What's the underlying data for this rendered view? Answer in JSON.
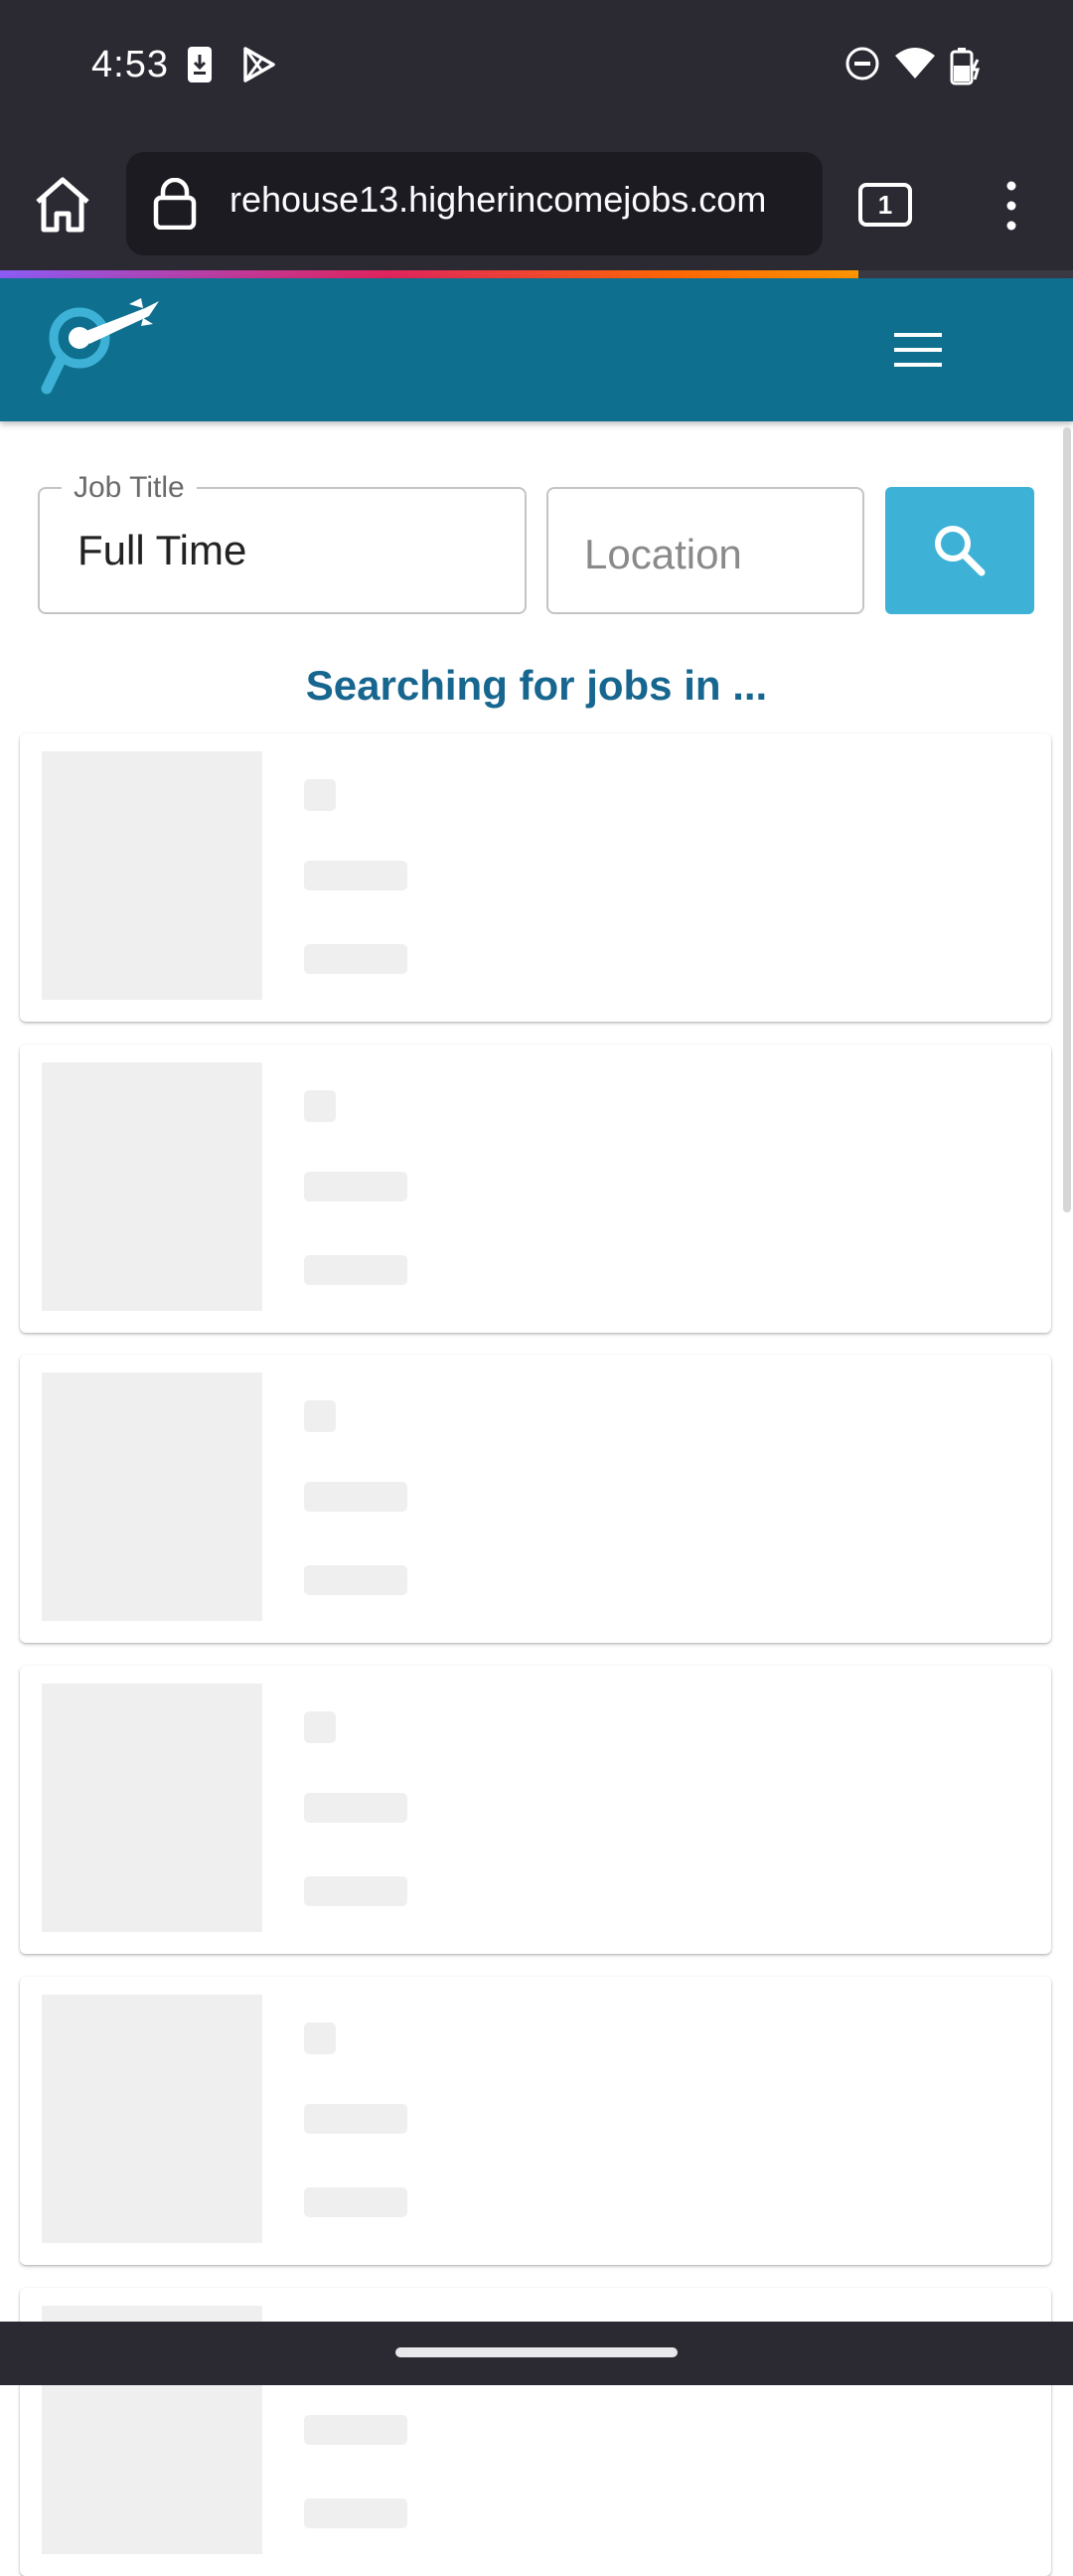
{
  "status_bar": {
    "time": "4:53",
    "left_icons": [
      "download-icon",
      "play-store-icon"
    ],
    "right_icons": [
      "do-not-disturb-icon",
      "wifi-icon",
      "battery-charging-icon"
    ]
  },
  "browser": {
    "url": "rehouse13.higherincomejobs.com",
    "tab_count": "1",
    "page_load_progress": 0.8,
    "icons": [
      "home-icon",
      "lock-icon",
      "tabs-icon",
      "overflow-menu-icon"
    ]
  },
  "site": {
    "header_color": "#0e6f8f",
    "accent_color": "#3eb2d6",
    "logo": "search-rocket-logo",
    "menu_icon": "hamburger-menu-icon"
  },
  "search_form": {
    "job_title_label": "Job Title",
    "job_title_value": "Full Time",
    "location_placeholder": "Location",
    "location_value": "",
    "search_button_icon": "search-icon"
  },
  "results": {
    "heading": "Searching for jobs in ...",
    "skeleton_cards": 6
  }
}
